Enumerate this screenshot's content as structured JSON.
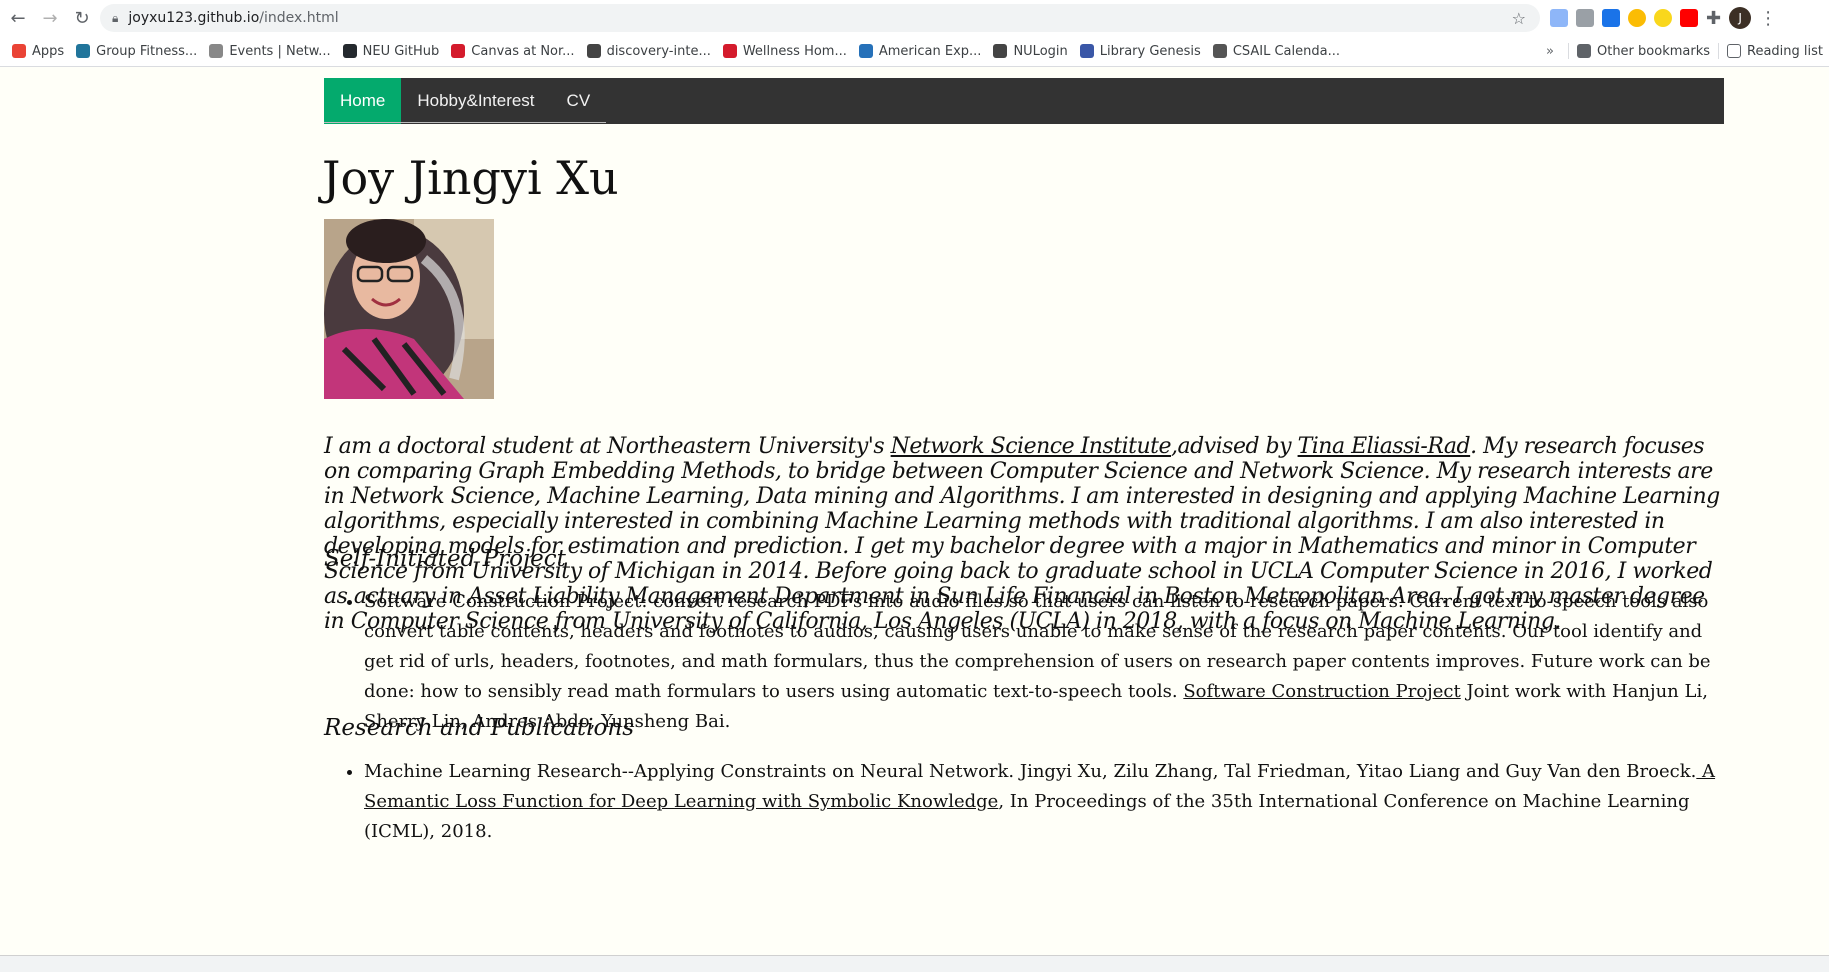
{
  "browser": {
    "url_host": "joyxu123.github.io",
    "url_path": "/index.html",
    "avatar_letter": "J",
    "bookmarks": [
      {
        "label": "Apps",
        "color": "#ea4335"
      },
      {
        "label": "Group Fitness...",
        "color": "#21759b"
      },
      {
        "label": "Events | Netw...",
        "color": "#888888"
      },
      {
        "label": "NEU GitHub",
        "color": "#24292e"
      },
      {
        "label": "Canvas at Nor...",
        "color": "#d41b2c"
      },
      {
        "label": "discovery-inte...",
        "color": "#444444"
      },
      {
        "label": "Wellness Hom...",
        "color": "#d41b2c"
      },
      {
        "label": "American Exp...",
        "color": "#2671b9"
      },
      {
        "label": "NULogin",
        "color": "#444444"
      },
      {
        "label": "Library Genesis",
        "color": "#3a57a7"
      },
      {
        "label": "CSAIL Calenda...",
        "color": "#555555"
      }
    ],
    "overflow_chevron": "»",
    "other_bookmarks": "Other bookmarks",
    "reading_list": "Reading list"
  },
  "nav": {
    "home": "Home",
    "hobby": "Hobby&Interest",
    "cv": "CV"
  },
  "page_title": "Joy Jingyi Xu",
  "bio": {
    "part1": "I am a doctoral student at Northeastern University's ",
    "link1": "Network Science Institute",
    "part2": ",advised by ",
    "link2": "Tina Eliassi-Rad",
    "part3": ". My research focuses on comparing Graph Embedding Methods, to bridge between Computer Science and Network Science. My research interests are in Network Science, Machine Learning, Data mining and Algorithms. I am interested in designing and applying Machine Learning algorithms, especially interested in combining Machine Learning methods with traditional algorithms. I am also interested in developing models for estimation and prediction. I get my bachelor degree with a major in Mathematics and minor in Computer Science from University of Michigan in 2014. Before going back to graduate school in UCLA Computer Science in 2016, I worked as actuary in Asset Liability Management Department in Sun Life Financial in Boston Metropolitan Area. I got my master degree in Computer Science from University of California, Los Angeles (UCLA) in 2018, with a focus on Machine Learning."
  },
  "section1": {
    "heading": "Self-Initiated Project",
    "item_text": "Software Construction Project: convert research PDFs into audio files so that users can listen to research papers. Current text-to-speech tools also convert table contents, headers and footnotes to audios, causing users unable to make sense of the research paper contents. Our tool identify and get rid of urls, headers, footnotes, and math formulars, thus the comprehension of users on research paper contents improves. Future work can be done: how to sensibly read math formulars to users using automatic text-to-speech tools. ",
    "item_link": "Software Construction Project",
    "item_after": " Joint work with Hanjun Li, Sherry Lin, Andres Abdo, Yunsheng Bai."
  },
  "section2": {
    "heading": "Research and Publications",
    "item_text": "Machine Learning Research--Applying Constraints on Neural Network. Jingyi Xu, Zilu Zhang, Tal Friedman, Yitao Liang and Guy Van den Broeck.",
    "item_link": " A Semantic Loss Function for Deep Learning with Symbolic Knowledge",
    "item_after": ", In Proceedings of the 35th International Conference on Machine Learning (ICML), 2018."
  }
}
